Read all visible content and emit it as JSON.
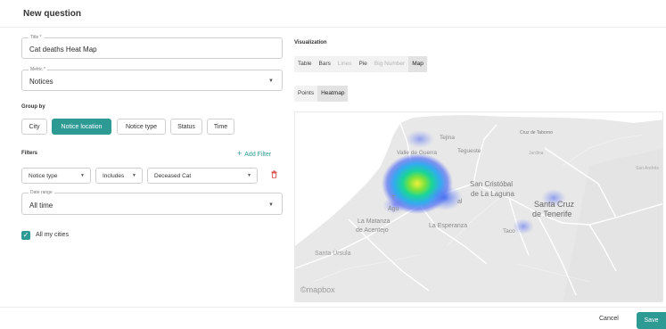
{
  "dialog": {
    "title": "New question"
  },
  "title_field": {
    "label": "Title *",
    "value": "Cat deaths Heat Map"
  },
  "metric_field": {
    "label": "Metric *",
    "value": "Notices"
  },
  "group_by": {
    "label": "Group by",
    "options": [
      {
        "label": "City",
        "active": false
      },
      {
        "label": "Notice location",
        "active": true
      },
      {
        "label": "Notice type",
        "active": false
      },
      {
        "label": "Status",
        "active": false
      },
      {
        "label": "Time",
        "active": false
      }
    ]
  },
  "filters": {
    "label": "Filters",
    "add_label": "Add Filter",
    "row": {
      "field": "Notice type",
      "operator": "Includes",
      "value": "Deceased Cat"
    }
  },
  "date_range": {
    "label": "Date range",
    "value": "All time"
  },
  "all_my_cities": {
    "label": "All my cities",
    "checked": true
  },
  "visualization": {
    "label": "Visualization",
    "types": [
      {
        "label": "Table",
        "state": "normal"
      },
      {
        "label": "Bars",
        "state": "normal"
      },
      {
        "label": "Lines",
        "state": "disabled"
      },
      {
        "label": "Pie",
        "state": "normal"
      },
      {
        "label": "Big Number",
        "state": "disabled"
      },
      {
        "label": "Map",
        "state": "selected"
      }
    ],
    "modes": [
      {
        "label": "Points",
        "selected": false
      },
      {
        "label": "Heatmap",
        "selected": true
      }
    ]
  },
  "map": {
    "labels": {
      "tejina": "Tejina",
      "cruz_taborno": "Cruz de Taborno",
      "valle_guerra": "Valle de Guerra",
      "tegueste": "Tegueste",
      "jardina": "Jardina",
      "san_andres": "San Andrés",
      "san_cristobal_1": "San Cristóbal",
      "san_cristobal_2": "de La Laguna",
      "santa_cruz_1": "Santa Cruz",
      "santa_cruz_2": "de Tenerife",
      "la_matanza_1": "La Matanza",
      "la_matanza_2": "de Acentejo",
      "la_esperanza": "La Esperanza",
      "taco": "Taco",
      "santa_ursula": "Santa Úrsula",
      "partial_1": "T",
      "partial_2": "Agu",
      "partial_3": "al",
      "attribution": "©mapbox"
    },
    "colors": {
      "land": "#e9e9e9",
      "sea": "#ffffff",
      "road": "#ffffff",
      "heat_core": "#f0f03a",
      "heat_mid": "#19d49a",
      "heat_outer": "#3d5cf5"
    }
  },
  "footer": {
    "cancel": "Cancel",
    "save": "Save"
  }
}
